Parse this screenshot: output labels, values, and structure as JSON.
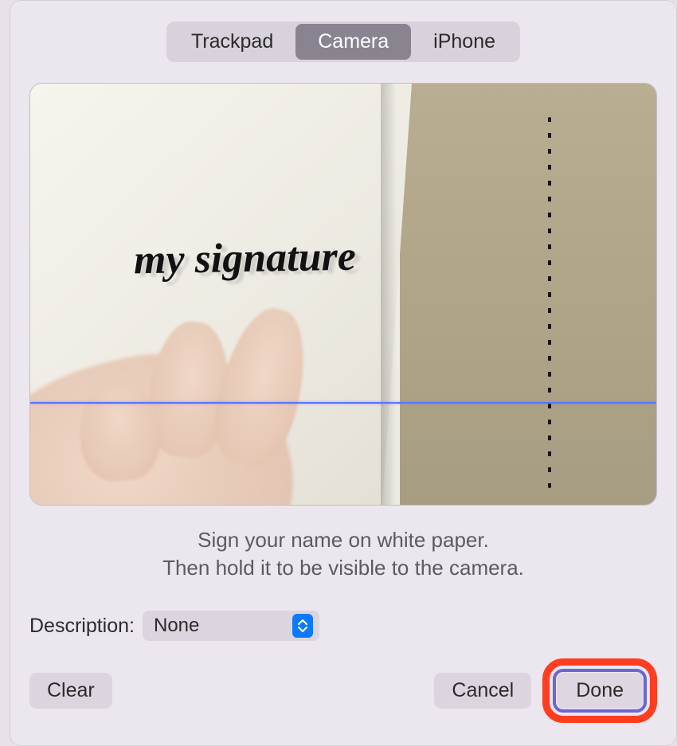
{
  "tabs": {
    "trackpad": "Trackpad",
    "camera": "Camera",
    "iphone": "iPhone",
    "active": "camera"
  },
  "preview": {
    "signature_text": "my signature"
  },
  "instructions": {
    "line1": "Sign your name on white paper.",
    "line2": "Then hold it to be visible to the camera."
  },
  "description": {
    "label": "Description:",
    "value": "None"
  },
  "buttons": {
    "clear": "Clear",
    "cancel": "Cancel",
    "done": "Done"
  }
}
